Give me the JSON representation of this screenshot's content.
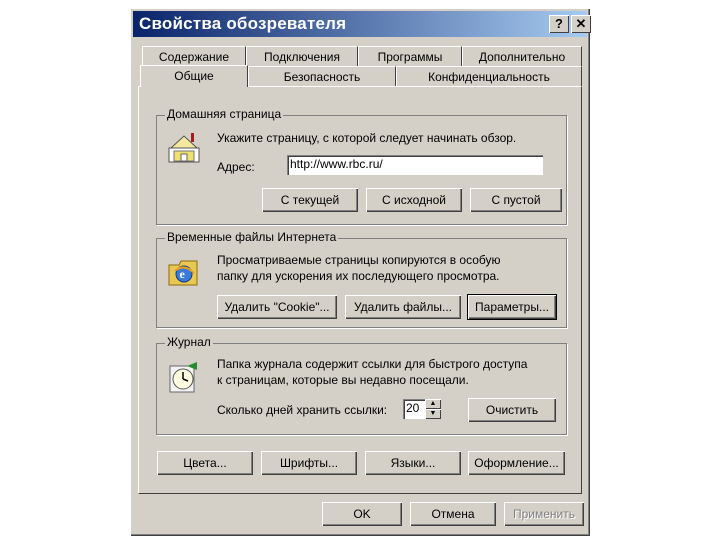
{
  "window": {
    "title": "Свойства обозревателя",
    "help_glyph": "?",
    "close_glyph": "✕"
  },
  "tabs_back": [
    "Содержание",
    "Подключения",
    "Программы",
    "Дополнительно"
  ],
  "tabs_front": [
    "Общие",
    "Безопасность",
    "Конфиденциальность"
  ],
  "active_tab": "Общие",
  "home": {
    "legend": "Домашняя страница",
    "description": "Укажите страницу, с которой следует начинать обзор.",
    "address_label": "Адрес:",
    "address_value": "http://www.rbc.ru/",
    "buttons": [
      "С текущей",
      "С исходной",
      "С пустой"
    ]
  },
  "temp": {
    "legend": "Временные файлы Интернета",
    "description_line1": "Просматриваемые страницы копируются в особую",
    "description_line2": "папку для ускорения их последующего просмотра.",
    "buttons": [
      "Удалить \"Cookie\"...",
      "Удалить файлы...",
      "Параметры..."
    ]
  },
  "history": {
    "legend": "Журнал",
    "description_line1": "Папка журнала содержит ссылки для быстрого доступа",
    "description_line2": "к страницам, которые вы недавно посещали.",
    "days_label": "Сколько дней хранить ссылки:",
    "days_value": "20",
    "clear_button": "Очистить"
  },
  "bottom_buttons": [
    "Цвета...",
    "Шрифты...",
    "Языки...",
    "Оформление..."
  ],
  "dialog_buttons": {
    "ok": "OK",
    "cancel": "Отмена",
    "apply": "Применить"
  },
  "icons": {
    "home": "home-page-icon",
    "temp": "ie-temp-files-icon",
    "history": "history-clock-icon"
  }
}
